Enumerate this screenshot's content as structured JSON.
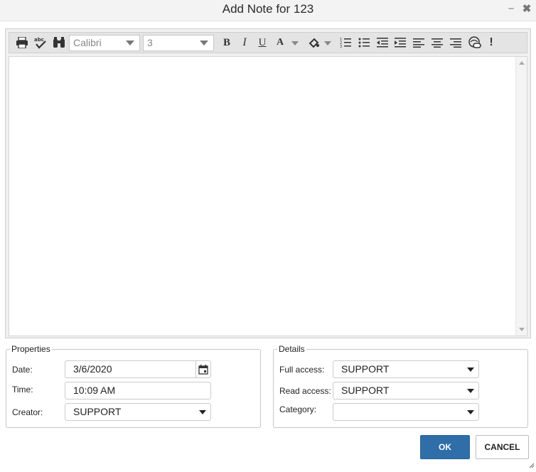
{
  "window": {
    "title": "Add Note for 123",
    "minimize_glyph": "−",
    "close_glyph": "✖"
  },
  "toolbar": {
    "font_name": "Calibri",
    "font_size": "3",
    "bold_glyph": "B",
    "italic_glyph": "I",
    "underline_glyph": "U",
    "font_color_glyph": "A",
    "important_glyph": "!"
  },
  "properties": {
    "legend": "Properties",
    "date_label": "Date:",
    "date_value": "3/6/2020",
    "time_label": "Time:",
    "time_value": "10:09 AM",
    "creator_label": "Creator:",
    "creator_value": "SUPPORT"
  },
  "details": {
    "legend": "Details",
    "full_access_label": "Full access:",
    "full_access_value": "SUPPORT",
    "read_access_label": "Read access:",
    "read_access_value": "SUPPORT",
    "category_label": "Category:",
    "category_value": ""
  },
  "buttons": {
    "ok": "OK",
    "cancel": "CANCEL"
  },
  "colors": {
    "ok_button": "#2f6ea8",
    "toolbar": "#e4e4e4"
  }
}
